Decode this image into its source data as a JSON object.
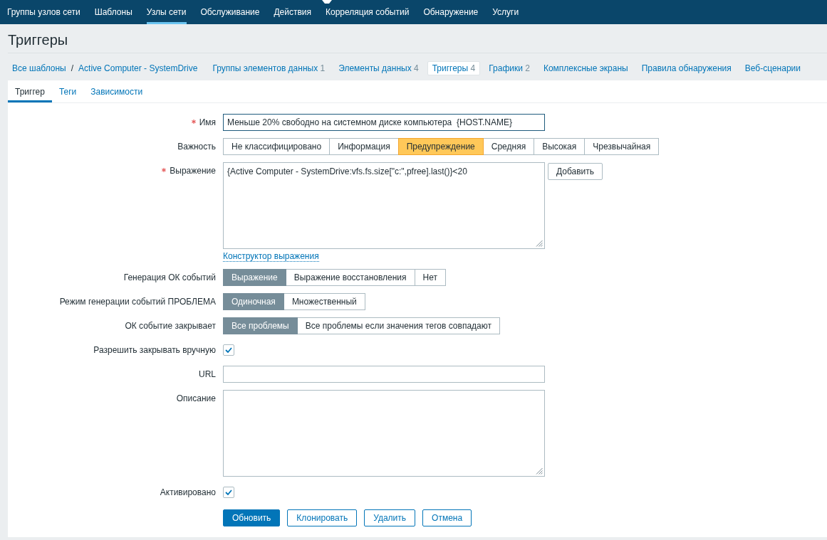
{
  "top_nav": {
    "items": [
      {
        "label": "Группы узлов сети",
        "selected": false
      },
      {
        "label": "Шаблоны",
        "selected": false
      },
      {
        "label": "Узлы сети",
        "selected": true
      },
      {
        "label": "Обслуживание",
        "selected": false
      },
      {
        "label": "Действия",
        "selected": false
      },
      {
        "label": "Корреляция событий",
        "selected": false
      },
      {
        "label": "Обнаружение",
        "selected": false
      },
      {
        "label": "Услуги",
        "selected": false
      }
    ]
  },
  "page_title": "Триггеры",
  "breadcrumbs": {
    "items": [
      "Все шаблоны",
      "Active Computer - SystemDrive"
    ],
    "separator": "/"
  },
  "section_tabs": [
    {
      "label": "Группы элементов данных",
      "count": "1",
      "selected": false
    },
    {
      "label": "Элементы данных",
      "count": "4",
      "selected": false
    },
    {
      "label": "Триггеры",
      "count": "4",
      "selected": true
    },
    {
      "label": "Графики",
      "count": "2",
      "selected": false
    },
    {
      "label": "Комплексные экраны",
      "selected": false
    },
    {
      "label": "Правила обнаружения",
      "selected": false
    },
    {
      "label": "Веб-сценарии",
      "selected": false
    }
  ],
  "form_tabs": [
    {
      "label": "Триггер",
      "selected": true
    },
    {
      "label": "Теги",
      "selected": false
    },
    {
      "label": "Зависимости",
      "selected": false
    }
  ],
  "fields": [
    {
      "kind": "text",
      "label": "Имя",
      "required": true,
      "focused": true,
      "value": "Меньше 20% свободно на системном диске компьютера  {HOST.NAME}"
    },
    {
      "kind": "severity",
      "label": "Важность",
      "options": [
        {
          "label": "Не классифицировано",
          "selected": false
        },
        {
          "label": "Информация",
          "selected": false
        },
        {
          "label": "Предупреждение",
          "selected": true
        },
        {
          "label": "Средняя",
          "selected": false
        },
        {
          "label": "Высокая",
          "selected": false
        },
        {
          "label": "Чрезвычайная",
          "selected": false
        }
      ]
    },
    {
      "kind": "textarea",
      "label": "Выражение",
      "required": true,
      "value": "{Active Computer - SystemDrive:vfs.fs.size[\"c:\",pfree].last()}<20",
      "button": "Добавить",
      "link": "Конструктор выражения"
    },
    {
      "kind": "radio",
      "label": "Генерация ОК событий",
      "options": [
        {
          "label": "Выражение",
          "selected": true
        },
        {
          "label": "Выражение восстановления",
          "selected": false
        },
        {
          "label": "Нет",
          "selected": false
        }
      ]
    },
    {
      "kind": "radio",
      "label": "Режим генерации событий ПРОБЛЕМА",
      "options": [
        {
          "label": "Одиночная",
          "selected": true
        },
        {
          "label": "Множественный",
          "selected": false
        }
      ]
    },
    {
      "kind": "radio",
      "label": "ОК событие закрывает",
      "options": [
        {
          "label": "Все проблемы",
          "selected": true
        },
        {
          "label": "Все проблемы если значения тегов совпадают",
          "selected": false
        }
      ]
    },
    {
      "kind": "checkbox",
      "label": "Разрешить закрывать вручную",
      "checked": true
    },
    {
      "kind": "text",
      "label": "URL",
      "required": false,
      "focused": false
    },
    {
      "kind": "textarea",
      "label": "Описание",
      "required": false
    },
    {
      "kind": "checkbox",
      "label": "Активировано",
      "checked": true
    }
  ],
  "buttons": [
    {
      "label": "Обновить",
      "kind": "primary"
    },
    {
      "label": "Клонировать",
      "kind": "secondary"
    },
    {
      "label": "Удалить",
      "kind": "secondary"
    },
    {
      "label": "Отмена",
      "kind": "secondary"
    }
  ]
}
